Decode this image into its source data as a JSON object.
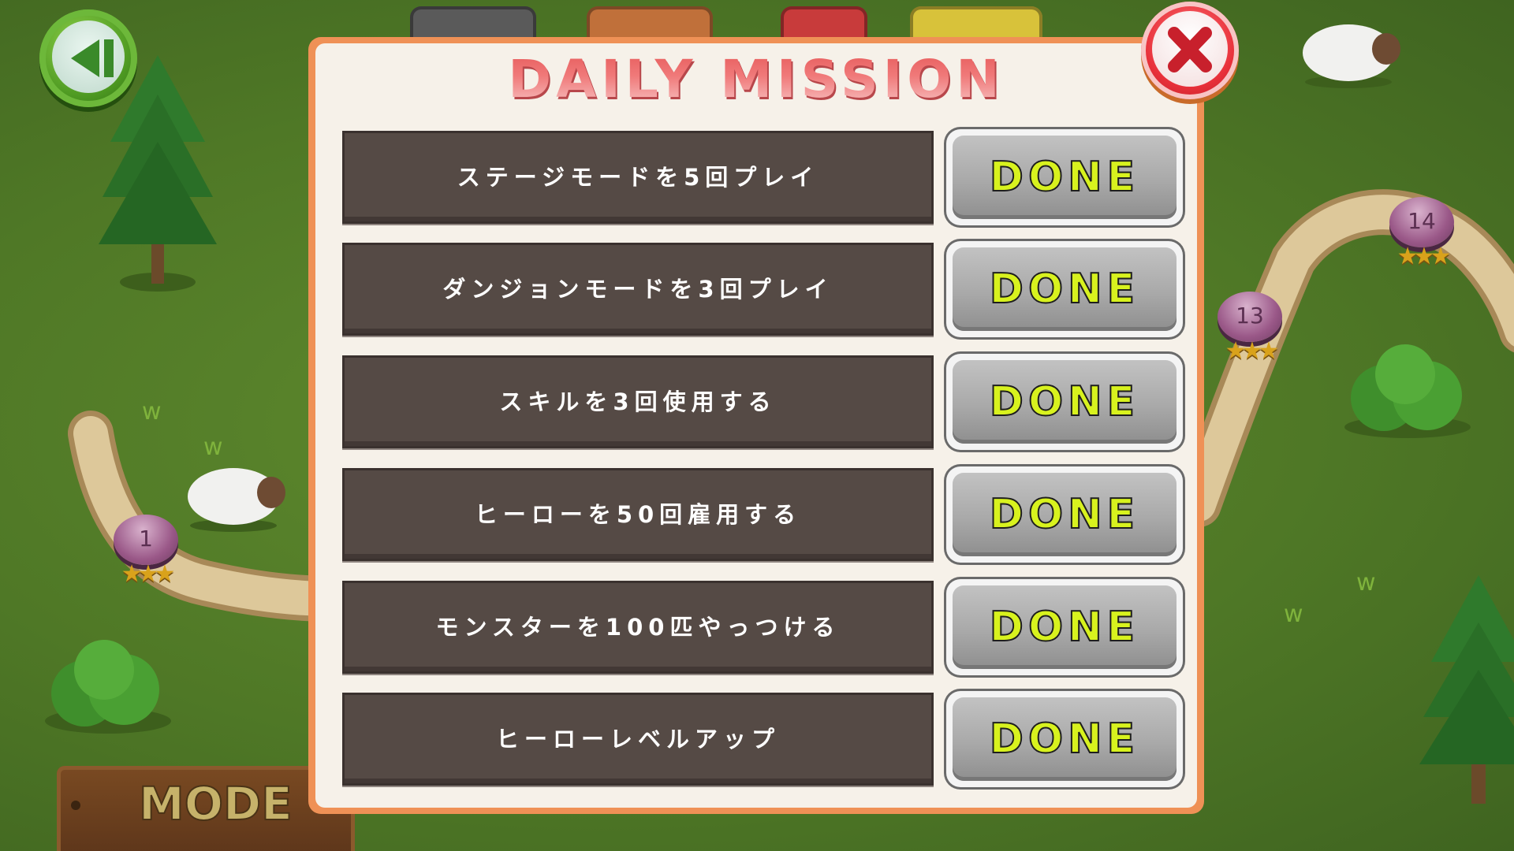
{
  "dialog": {
    "title": "DAILY MISSION",
    "missions": [
      {
        "text": "ステージモードを5回プレイ",
        "button": "DONE"
      },
      {
        "text": "ダンジョンモードを3回プレイ",
        "button": "DONE"
      },
      {
        "text": "スキルを3回使用する",
        "button": "DONE"
      },
      {
        "text": "ヒーローを50回雇用する",
        "button": "DONE"
      },
      {
        "text": "モンスターを100匹やっつける",
        "button": "DONE"
      },
      {
        "text": "ヒーローレベルアップ",
        "button": "DONE"
      }
    ]
  },
  "map": {
    "stages": [
      {
        "number": "1",
        "stars": "★★★"
      },
      {
        "number": "13",
        "stars": "★★★"
      },
      {
        "number": "14",
        "stars": "★★★"
      }
    ],
    "mode_label": "MODE"
  },
  "icons": {
    "back": "back-arrow-icon",
    "close": "close-x-icon",
    "star": "star-icon"
  },
  "colors": {
    "grass": "#4f7826",
    "dialog_border": "#ef9156",
    "dialog_bg": "#f6f1e9",
    "mission_box": "#554a45",
    "done_text": "#d8f21e",
    "title": "#e65a5a",
    "close_button": "#e8303a"
  }
}
